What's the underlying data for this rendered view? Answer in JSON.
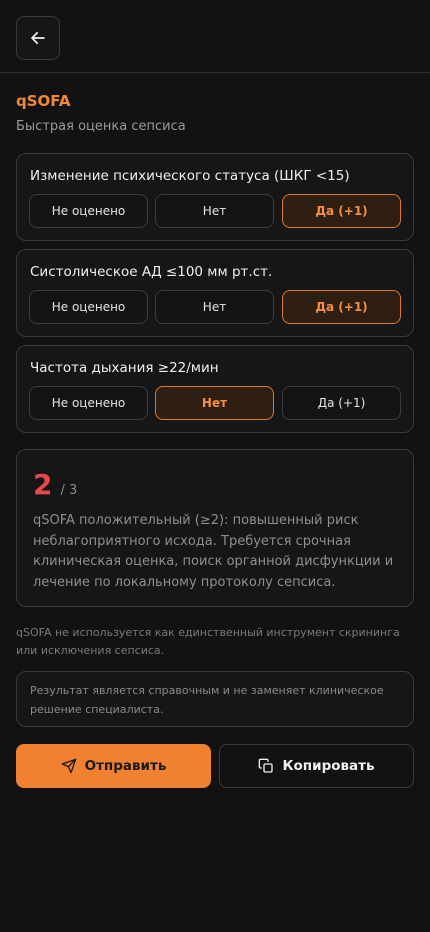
{
  "header": {
    "back_icon": "arrow-left-icon"
  },
  "page": {
    "title": "qSOFA",
    "subtitle": "Быстрая оценка сепсиса"
  },
  "criteria": [
    {
      "label": "Изменение психического статуса (ШКГ <15)",
      "options": [
        "Не оценено",
        "Нет",
        "Да (+1)"
      ],
      "selected": "Да (+1)"
    },
    {
      "label": "Систолическое АД ≤100 мм рт.ст.",
      "options": [
        "Не оценено",
        "Нет",
        "Да (+1)"
      ],
      "selected": "Да (+1)"
    },
    {
      "label": "Частота дыхания ≥22/мин",
      "options": [
        "Не оценено",
        "Нет",
        "Да (+1)"
      ],
      "selected": "Нет"
    }
  ],
  "result": {
    "score": "2",
    "total": "/ 3",
    "text": "qSOFA положительный (≥2): повышенный риск неблагоприятного исхода. Требуется срочная клиническая оценка, поиск органной дисфункции и лечение по локальному протоколу сепсиса."
  },
  "note": "qSOFA не используется как единственный инструмент скрининга или исключения сепсиса.",
  "disclaimer": "Результат является справочным и не заменяет клиническое решение специалиста.",
  "actions": {
    "send_label": "Отправить",
    "send_icon": "send-icon",
    "copy_label": "Копировать",
    "copy_icon": "copy-icon"
  },
  "colors": {
    "accent": "#ef8130",
    "score": "#e5484d",
    "background": "#121212"
  }
}
